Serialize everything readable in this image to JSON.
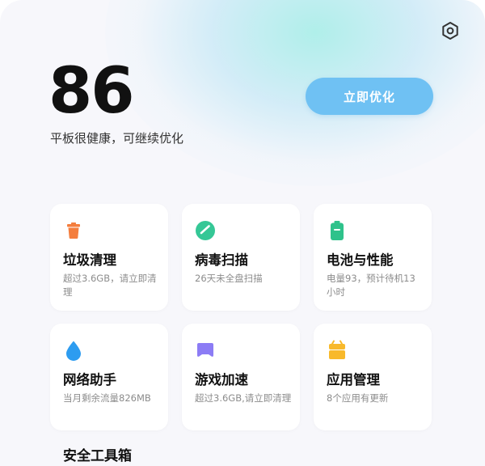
{
  "header": {
    "score": "86",
    "status_text": "平板很健康，可继续优化",
    "optimize_label": "立即优化",
    "settings_icon": "settings-hexagon-icon"
  },
  "cards": [
    {
      "title": "垃圾清理",
      "desc": "超过3.6GB，请立即清理",
      "icon": "trash-icon",
      "color": "#f47e3e"
    },
    {
      "title": "病毒扫描",
      "desc": "26天未全盘扫描",
      "icon": "shield-scan-icon",
      "color": "#35c796"
    },
    {
      "title": "电池与性能",
      "desc": "电量93，预计待机13小时",
      "icon": "battery-icon",
      "color": "#2fc28b"
    },
    {
      "title": "网络助手",
      "desc": "当月剩余流量826MB",
      "icon": "water-drop-icon",
      "color": "#2d9cf0"
    },
    {
      "title": "游戏加速",
      "desc": "超过3.6GB,请立即清理",
      "icon": "gamepad-icon",
      "color": "#8c7cf5"
    },
    {
      "title": "应用管理",
      "desc": "8个应用有更新",
      "icon": "app-package-icon",
      "color": "#f8b92b"
    }
  ],
  "section": {
    "title": "安全工具箱"
  }
}
